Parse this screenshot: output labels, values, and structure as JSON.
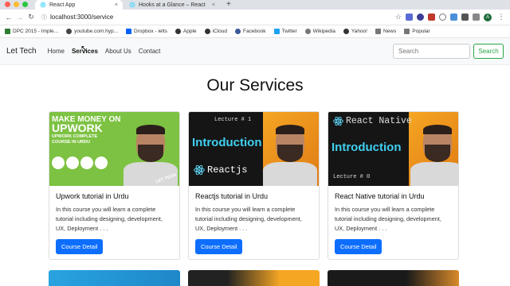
{
  "browser": {
    "tabs": [
      {
        "title": "React App",
        "active": true
      },
      {
        "title": "Hooks at a Glance – React",
        "active": false
      }
    ],
    "url": "localhost:3000/service",
    "bookmarks": [
      "DPC 2015 - Imple...",
      "youtube.com.hyp...",
      "Dropbox - ielts",
      "Apple",
      "iCloud",
      "Facebook",
      "Twitter",
      "Wikipedia",
      "Yahoo!",
      "News",
      "Popular"
    ],
    "avatar_letter": "A"
  },
  "navbar": {
    "brand": "Let Tech",
    "links": [
      "Home",
      "Services",
      "About Us",
      "Contact"
    ],
    "active_link": "Services",
    "search_placeholder": "Search",
    "search_button": "Search"
  },
  "page": {
    "title": "Our Services",
    "cards": [
      {
        "title": "Upwork tutorial in Urdu",
        "text": "In this course you will learn a complete tutorial including designing, development, UX, Deployment . . .",
        "button": "Course Detail",
        "thumb": {
          "line1": "MAKE MONEY ON",
          "line2": "UPWORK",
          "line3": "UPWORK COMPLETE COURSE IN URDU",
          "tag": "LET TECH"
        }
      },
      {
        "title": "Reactjs tutorial in Urdu",
        "text": "In this course you will learn a complete tutorial including designing, development, UX, Deployment . . .",
        "button": "Course Detail",
        "thumb": {
          "lecture": "Lecture # 1",
          "heading": "Introduction",
          "tech": "Reactjs"
        }
      },
      {
        "title": "React Native tutorial in Urdu",
        "text": "In this course you will learn a complete tutorial including designing, development, UX, Deployment . . .",
        "button": "Course Detail",
        "thumb": {
          "tech": "React Native",
          "heading": "Introduction",
          "lecture": "Lecture # 0"
        }
      }
    ]
  },
  "colors": {
    "primary": "#0d6efd",
    "success": "#28a745",
    "upwork_green": "#7dc242",
    "react_cyan": "#3fd0f0"
  }
}
